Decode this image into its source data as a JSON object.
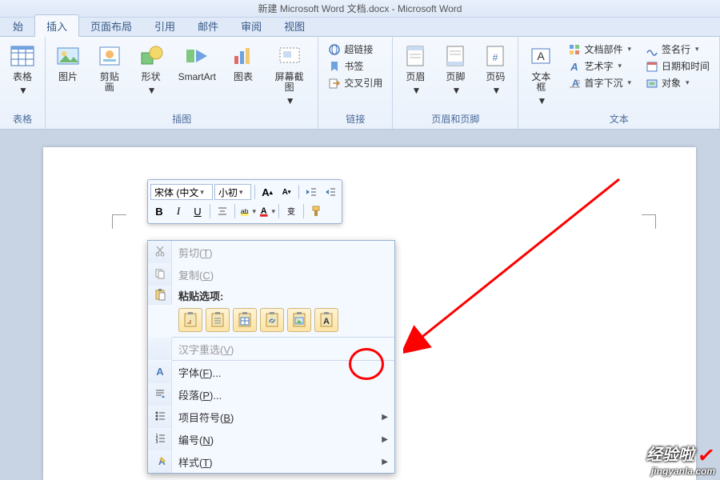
{
  "title": "新建 Microsoft Word 文档.docx - Microsoft Word",
  "tabs": [
    "始",
    "插入",
    "页面布局",
    "引用",
    "邮件",
    "审阅",
    "视图"
  ],
  "active_tab": 1,
  "groups": {
    "tables": {
      "label": "表格",
      "items": [
        "表格"
      ]
    },
    "illust": {
      "label": "插图",
      "items": [
        "图片",
        "剪贴画",
        "形状",
        "SmartArt",
        "图表",
        "屏幕截图"
      ]
    },
    "links": {
      "label": "链接",
      "items": [
        "超链接",
        "书签",
        "交叉引用"
      ]
    },
    "headerfooter": {
      "label": "页眉和页脚",
      "items": [
        "页眉",
        "页脚",
        "页码"
      ]
    },
    "text": {
      "label": "文本",
      "items": [
        "文本框",
        "文档部件",
        "艺术字",
        "首字下沉",
        "签名行",
        "日期和时间",
        "对象"
      ]
    }
  },
  "mini": {
    "font": "宋体 (中文",
    "size": "小初",
    "bold": "B",
    "italic": "I",
    "underline": "U"
  },
  "ctx": {
    "cut": "剪切(T)",
    "copy": "复制(C)",
    "paste_header": "粘贴选项:",
    "reconvert": "汉字重选(V)",
    "font": "字体(F)...",
    "para": "段落(P)...",
    "bullets": "项目符号(B)",
    "numbering": "编号(N)",
    "styles": "样式(T)"
  },
  "watermark": {
    "t1": "经验啦",
    "t2": "jingyanla.com"
  }
}
